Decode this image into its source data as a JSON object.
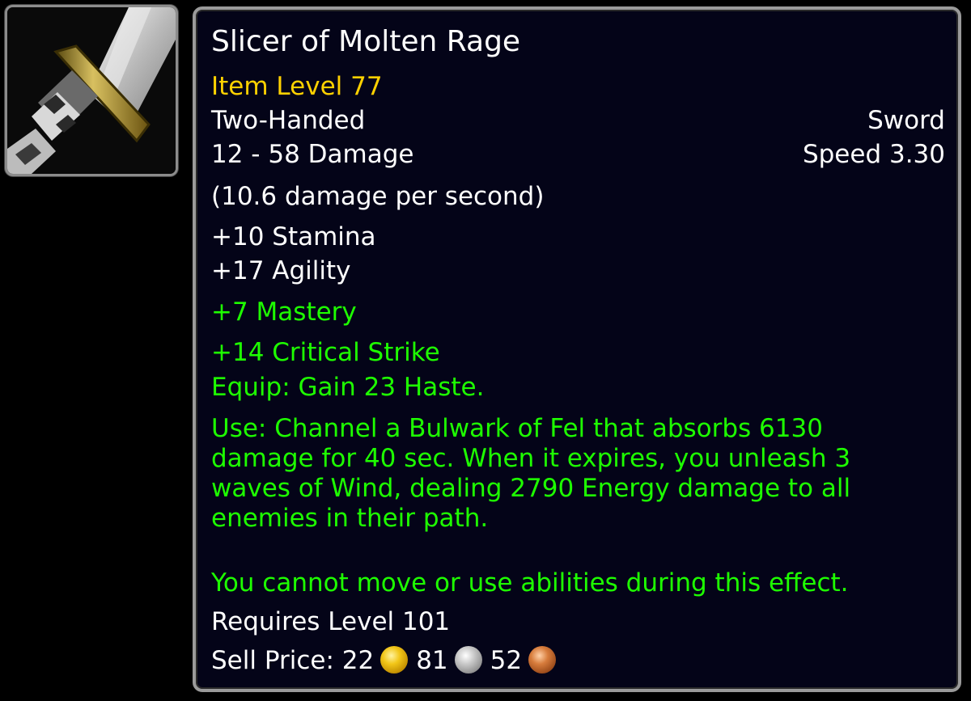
{
  "item": {
    "name": "Slicer of Molten Rage",
    "item_level": "Item Level 77",
    "slot": "Two-Handed",
    "type": "Sword",
    "damage": "12 - 58 Damage",
    "speed": "Speed 3.30",
    "dps": "(10.6 damage per second)",
    "stats": [
      "+10 Stamina",
      "+17 Agility"
    ],
    "green_stats": [
      "+7 Mastery",
      "+14 Critical Strike"
    ],
    "equip": "Equip: Gain 23 Haste.",
    "use": "Use: Channel a Bulwark of Fel that absorbs 6130\ndamage for 40 sec. When it expires, you unleash 3\nwaves of Wind, dealing 2790 Energy damage to all\nenemies in their path.",
    "use_note": "You cannot move or use abilities during this effect.",
    "requires": "Requires Level 101",
    "sell_label": "Sell Price: 22",
    "silver": "81",
    "copper": "52",
    "icon": "sword-icon"
  },
  "colors": {
    "title": "#ffffff",
    "item_level": "#ffd100",
    "green": "#1eff00",
    "background": "#040418",
    "border": "#9a9a9a"
  }
}
